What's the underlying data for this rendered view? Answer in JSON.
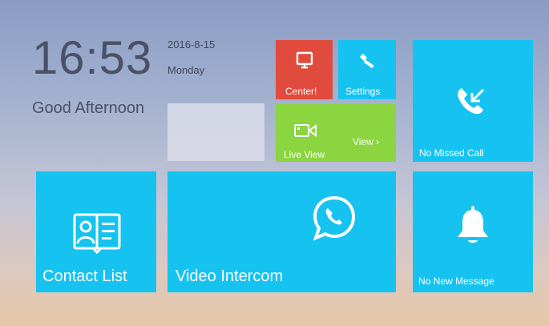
{
  "clock": {
    "time": "16:53",
    "greeting": "Good Afternoon",
    "date": "2016-8-15",
    "weekday": "Monday"
  },
  "tiles": {
    "center": {
      "label": "Center!",
      "icon": "monitor-icon",
      "color": "#e04b3e"
    },
    "settings": {
      "label": "Settings",
      "icon": "wrench-icon",
      "color": "#16c3f0"
    },
    "live_view": {
      "label": "Live View",
      "link": "View",
      "icon": "camera-icon",
      "color": "#8bd540"
    },
    "missed_call": {
      "label": "No Missed Call",
      "icon": "missed-call-icon",
      "color": "#16c3f0"
    },
    "contact_list": {
      "label": "Contact List",
      "icon": "contact-book-icon",
      "color": "#16c3f0"
    },
    "video_intercom": {
      "label": "Video Intercom",
      "icon": "phone-bubble-icon",
      "color": "#16c3f0"
    },
    "messages": {
      "label": "No New Message",
      "icon": "bell-icon",
      "color": "#16c3f0"
    }
  }
}
